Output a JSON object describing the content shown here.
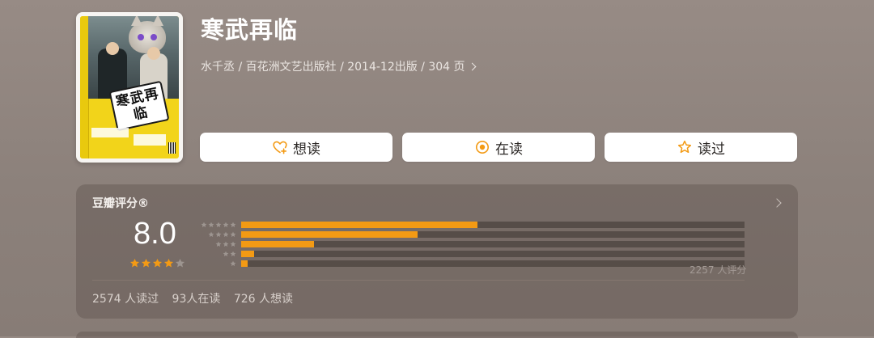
{
  "book": {
    "title": "寒武再临",
    "meta": "水千丞 / 百花洲文艺出版社 / 2014-12出版 / 304 页",
    "cover_title": "寒武再临"
  },
  "actions": {
    "want_label": "想读",
    "reading_label": "在读",
    "read_label": "读过",
    "want_icon": "heart-plus-icon",
    "reading_icon": "circle-dot-icon",
    "read_icon": "star-outline-icon"
  },
  "rating": {
    "header": "豆瓣评分®",
    "score": "8.0",
    "score_stars": 4,
    "distribution": [
      {
        "stars": 5,
        "fraction": 0.47
      },
      {
        "stars": 4,
        "fraction": 0.35
      },
      {
        "stars": 3,
        "fraction": 0.145
      },
      {
        "stars": 2,
        "fraction": 0.025
      },
      {
        "stars": 1,
        "fraction": 0.013
      }
    ],
    "count": "2257 人评分",
    "stats": {
      "read": "2574 人读过",
      "reading": "93人在读",
      "want": "726 人想读"
    }
  },
  "colors": {
    "accent": "#f39a14",
    "star_filled": "#f39a14",
    "star_empty": "#9d9590"
  }
}
